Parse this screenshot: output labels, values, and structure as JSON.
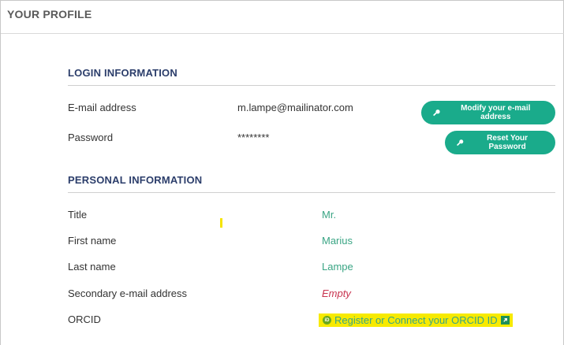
{
  "header": {
    "title": "YOUR PROFILE"
  },
  "login": {
    "section_title": "LOGIN INFORMATION",
    "email_label": "E-mail address",
    "email_value": "m.lampe@mailinator.com",
    "password_label": "Password",
    "password_value": "********",
    "modify_email_button": "Modify your e-mail address",
    "reset_password_button": "Reset Your Password"
  },
  "personal": {
    "section_title": "PERSONAL INFORMATION",
    "fields": [
      {
        "label": "Title",
        "value": "Mr."
      },
      {
        "label": "First name",
        "value": "Marius"
      },
      {
        "label": "Last name",
        "value": "Lampe"
      },
      {
        "label": "Secondary e-mail address",
        "value": "Empty"
      },
      {
        "label": "ORCID",
        "value": "Register or Connect your ORCID ID"
      }
    ]
  },
  "icons": {
    "key_icon": "key-icon",
    "orcid_icon": "orcid-icon",
    "external_link_icon": "external-link-icon"
  },
  "colors": {
    "accent": "#1aab8b",
    "section_title": "#2c3e6b",
    "value_green": "#3aa584",
    "empty_red": "#c8344f",
    "highlight": "#f7ea00"
  }
}
